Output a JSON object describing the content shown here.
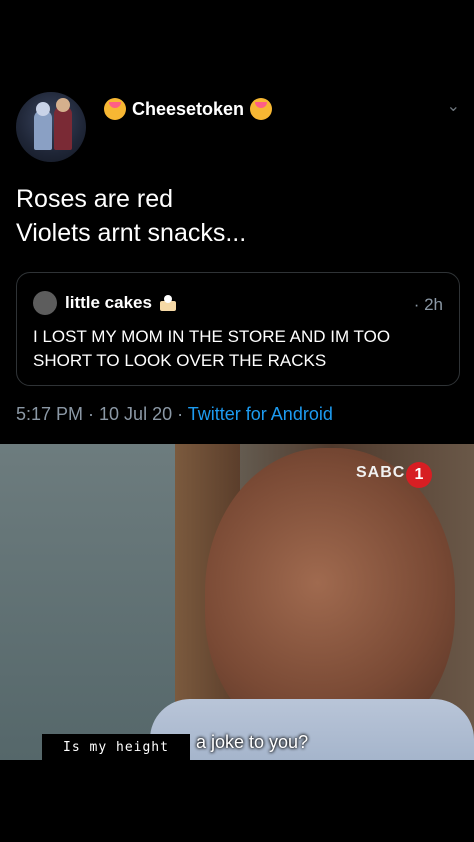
{
  "tweet": {
    "author_name": "Cheesetoken",
    "author_badge_icons": [
      "partying-face-icon",
      "partying-face-icon"
    ],
    "text_line1": "Roses are red",
    "text_line2": "Violets arnt snacks...",
    "timestamp": "5:17 PM · 10 Jul 20 ·",
    "source": "Twitter for Android"
  },
  "quoted_tweet": {
    "author_name": "little cakes",
    "author_badge_icon": "cake-icon",
    "time_ago": "· 2h",
    "text": "I LOST MY MOM IN THE STORE AND IM TOO SHORT TO LOOK OVER THE RACKS"
  },
  "meme": {
    "channel_logo": "SABC",
    "channel_number": "1",
    "caption_boxed": "Is my height",
    "caption_plain": "a joke to you?"
  },
  "colors": {
    "background": "#000000",
    "text": "#ffffff",
    "muted": "#8b98a5",
    "link": "#1d9bf0",
    "border": "#2f3336"
  }
}
